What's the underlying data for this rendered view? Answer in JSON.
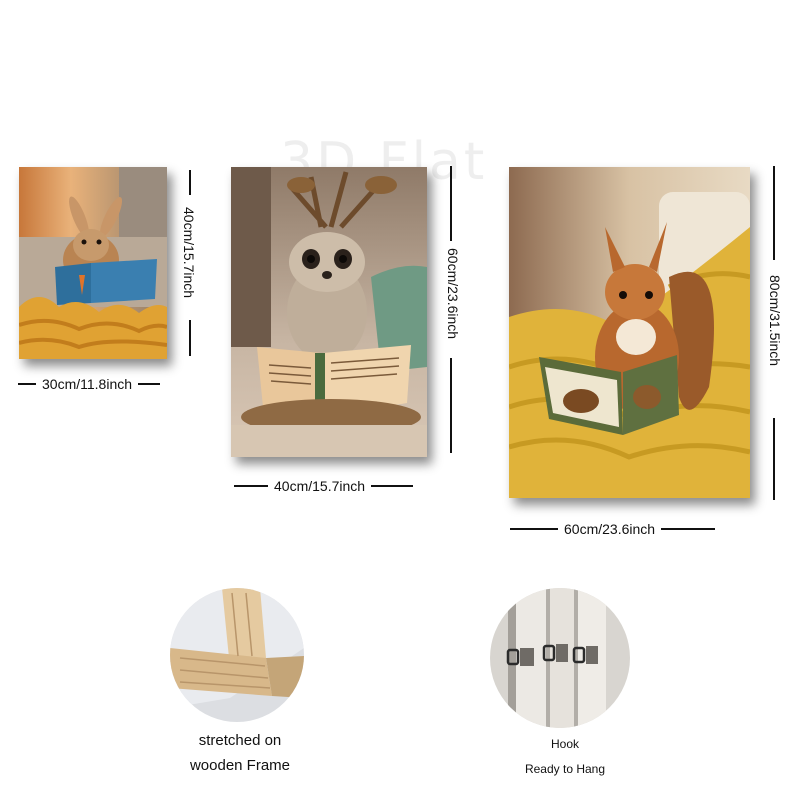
{
  "watermark": "3D Flat",
  "panels": [
    {
      "subject": "rabbit reading book",
      "width_label": "30cm/11.8inch",
      "height_label": "40cm/15.7inch"
    },
    {
      "subject": "meerkat reading book",
      "width_label": "40cm/15.7inch",
      "height_label": "60cm/23.6inch"
    },
    {
      "subject": "squirrel reading book",
      "width_label": "60cm/23.6inch",
      "height_label": "80cm/31.5inch"
    }
  ],
  "features": [
    {
      "icon": "wooden-frame-icon",
      "line1": "stretched on",
      "line2": "wooden Frame"
    },
    {
      "icon": "hook-icon",
      "line1": "Hook",
      "line2": "Ready to Hang"
    }
  ],
  "colors": {
    "dimension_line": "#111111",
    "knit_yellow": "#e0b33a",
    "knit_green": "#6f9a84"
  }
}
